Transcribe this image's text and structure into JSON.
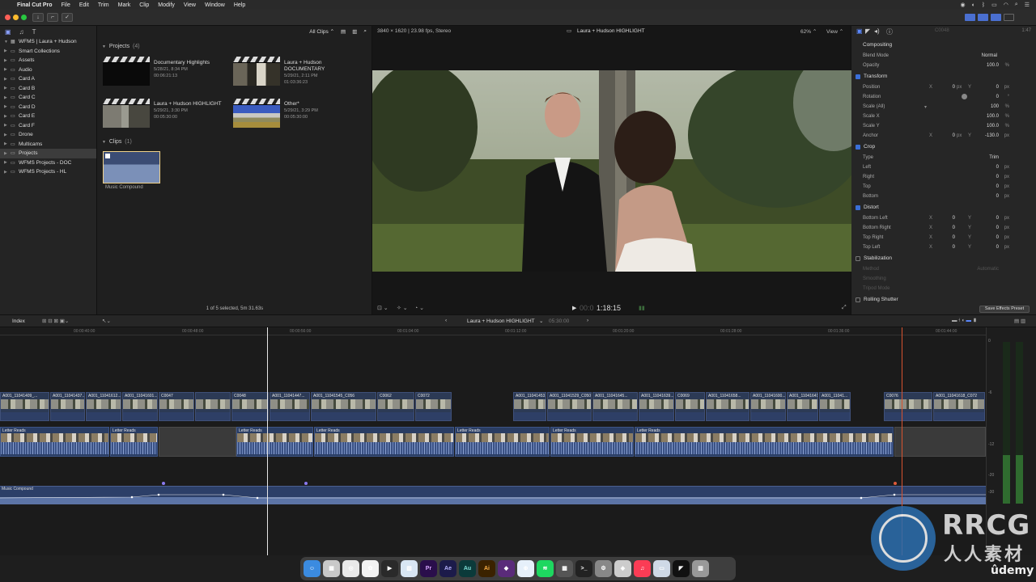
{
  "menubar": {
    "apple": "",
    "app_name": "Final Cut Pro",
    "items": [
      "File",
      "Edit",
      "Trim",
      "Mark",
      "Clip",
      "Modify",
      "View",
      "Window",
      "Help"
    ]
  },
  "toolbar": {
    "import_icon": "download-icon",
    "keyword_icon": "key-icon",
    "check_icon": "check-icon"
  },
  "sidebar": {
    "library_name": "WFMS | Laura + Hudson",
    "items": [
      {
        "label": "Smart Collections",
        "icon": "folder-icon"
      },
      {
        "label": "Assets",
        "icon": "folder-icon"
      },
      {
        "label": "Audio",
        "icon": "folder-icon"
      },
      {
        "label": "Card A",
        "icon": "folder-icon"
      },
      {
        "label": "Card B",
        "icon": "folder-icon"
      },
      {
        "label": "Card C",
        "icon": "folder-icon"
      },
      {
        "label": "Card D",
        "icon": "folder-icon"
      },
      {
        "label": "Card E",
        "icon": "folder-icon"
      },
      {
        "label": "Card F",
        "icon": "folder-icon"
      },
      {
        "label": "Drone",
        "icon": "folder-icon"
      },
      {
        "label": "Multicams",
        "icon": "folder-icon"
      },
      {
        "label": "Projects",
        "icon": "folder-icon"
      },
      {
        "label": "WFMS Projects - DOC",
        "icon": "folder-icon"
      },
      {
        "label": "WFMS Projects - HL",
        "icon": "folder-icon"
      }
    ]
  },
  "browser": {
    "filter": "All Clips",
    "projects_title": "Projects",
    "projects_count": "(4)",
    "projects": [
      {
        "name": "Documentary Highlights",
        "date": "5/28/21, 8:34 PM",
        "duration": "00:06:21:13"
      },
      {
        "name": "Laura + Hudson DOCUMENTARY",
        "date": "5/29/21, 2:11 PM",
        "duration": "01:03:36:23"
      },
      {
        "name": "Laura + Hudson HIGHLIGHT",
        "date": "5/29/21, 3:30 PM",
        "duration": "00:05:30:00"
      },
      {
        "name": "Other*",
        "date": "5/29/21, 3:29 PM",
        "duration": "00:05:30:00"
      }
    ],
    "clips_title": "Clips",
    "clips_count": "(1)",
    "clip_name": "Music Compound",
    "status": "1 of 5 selected, 5m 31.63s"
  },
  "viewer": {
    "format": "3840 × 1620 | 23.98 fps, Stereo",
    "title": "Laura + Hudson HIGHLIGHT",
    "zoom": "62%",
    "view_label": "View",
    "timecode_dim": "00:0",
    "timecode": "1:18:15"
  },
  "inspector": {
    "clip_name": "C0048",
    "duration": "1:47",
    "compositing": "Compositing",
    "blend_mode_label": "Blend Mode",
    "blend_mode": "Normal",
    "opacity_label": "Opacity",
    "opacity": "100.0",
    "transform": "Transform",
    "position_label": "Position",
    "position_x": "0",
    "position_y": "0",
    "rotation_label": "Rotation",
    "rotation": "0",
    "scale_all_label": "Scale (All)",
    "scale_all": "100",
    "scale_x_label": "Scale X",
    "scale_x": "100.0",
    "scale_y_label": "Scale Y",
    "scale_y": "100.0",
    "anchor_label": "Anchor",
    "anchor_x": "0",
    "anchor_y": "-130.0",
    "crop": "Crop",
    "type_label": "Type",
    "type": "Trim",
    "left_label": "Left",
    "left": "0",
    "right_label": "Right",
    "right": "0",
    "top_label": "Top",
    "top": "0",
    "bottom_label": "Bottom",
    "bottom": "0",
    "distort": "Distort",
    "bottom_left_label": "Bottom Left",
    "bottom_left_x": "0",
    "bottom_left_y": "0",
    "bottom_right_label": "Bottom Right",
    "bottom_right_x": "0",
    "bottom_right_y": "0",
    "top_right_label": "Top Right",
    "top_right_x": "0",
    "top_right_y": "0",
    "top_left_label": "Top Left",
    "top_left_x": "0",
    "top_left_y": "0",
    "stabilization": "Stabilization",
    "method_label": "Method",
    "method": "Automatic",
    "smoothing_label": "Smoothing",
    "tripod_label": "Tripod Mode",
    "rolling_shutter": "Rolling Shutter",
    "save_preset": "Save Effects Preset",
    "units": {
      "px": "px",
      "pct": "%",
      "deg": "°"
    },
    "axis_x": "X",
    "axis_y": "Y"
  },
  "timeline": {
    "index_label": "Index",
    "project_name": "Laura + Hudson HIGHLIGHT",
    "duration": "05:30:00",
    "ruler_labels": [
      "00:00:40:00",
      "00:00:48:00",
      "00:00:56:00",
      "00:01:04:00",
      "00:01:12:00",
      "00:01:20:00",
      "00:01:28:00",
      "00:01:36:00",
      "00:01:44:00"
    ],
    "video_clips": [
      "A001_11041409_...",
      "A001_11041437...",
      "A001_11041612...",
      "A001_11041601...",
      "C0047",
      "C0048",
      "A001_11041447...",
      "A001_11041545_C056",
      "C0062",
      "C0072",
      "A001_11041453...",
      "A001_11041529_C050",
      "A001_11041645...",
      "A001_11041639...",
      "C0069",
      "A001_11041658...",
      "A001_11041600...",
      "A001_11041641...",
      "A001_11041...",
      "C0076",
      "A001_11041618_C072"
    ],
    "audio_clip_label": "Letter Reads",
    "music_label": "Music Compound",
    "meter_labels": [
      "0",
      "-6",
      "-12",
      "-20",
      "-30"
    ]
  },
  "dock": {
    "apps": [
      "Finder",
      "Launchpad",
      "Chrome",
      "Photos",
      "Final Cut Pro",
      "Preview",
      "Pr",
      "Ae",
      "Au",
      "Ai",
      "Motion",
      "Safari",
      "Spotify",
      "Calculator",
      "Terminal",
      "Settings",
      "Compressor",
      "Music",
      "Preview2",
      "Unknown",
      "Trash"
    ]
  },
  "watermarks": {
    "rrcg": "RRCG",
    "rrcg_sub": "人人素材",
    "udemy": "ûdemy"
  }
}
